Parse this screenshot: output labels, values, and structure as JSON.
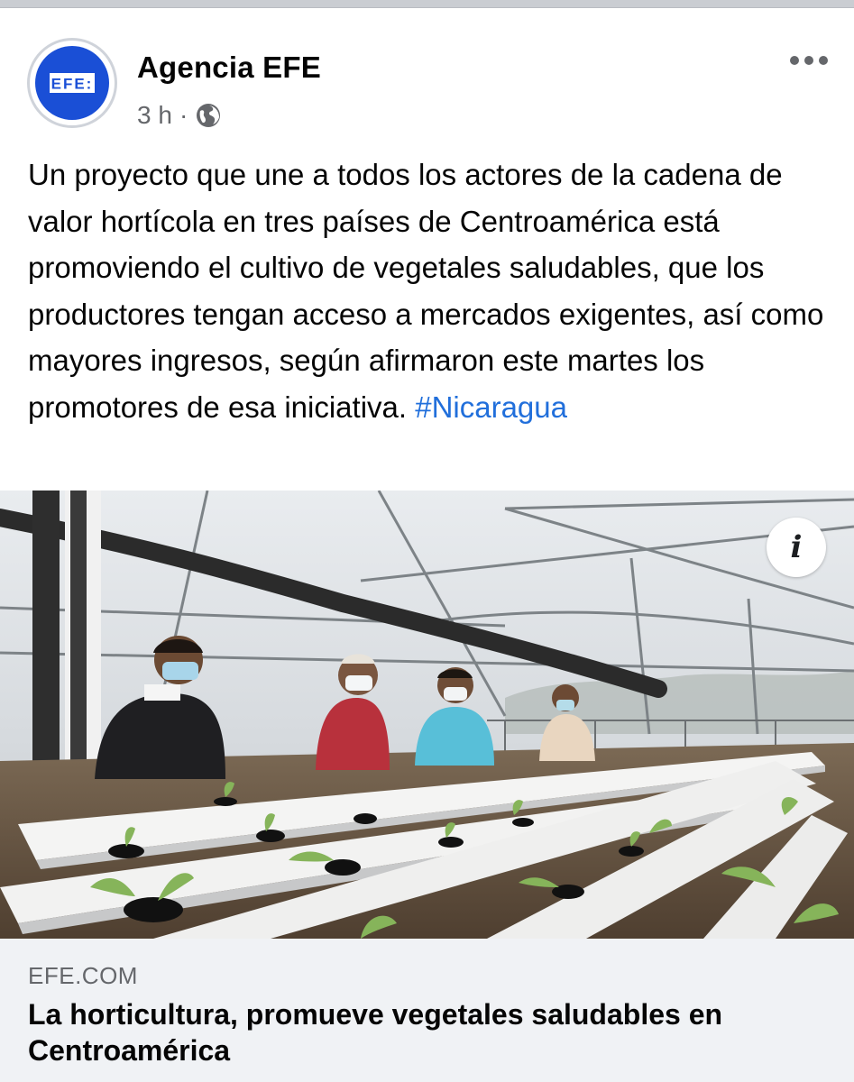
{
  "post": {
    "author": "Agencia EFE",
    "avatar_logo_text": "EFE:",
    "timestamp": "3 h",
    "separator": "·",
    "audience_icon": "globe-icon",
    "more_icon": "more-horizontal-icon",
    "body": "Un proyecto que une a todos los actores de la cadena de valor hortícola en tres países de Centroamérica está promoviendo el cultivo de vegetales saludables, que los productores tengan acceso a mercados exigentes, así como mayores ingresos, según afirmaron este martes los promotores de esa iniciativa.",
    "hashtag": "#Nicaragua"
  },
  "media": {
    "info_icon_label": "i"
  },
  "link_preview": {
    "domain": "EFE.COM",
    "title": "La horticultura, promueve vegetales saludables en Centroamérica"
  },
  "colors": {
    "brand_blue": "#1a4fd6",
    "hashtag_blue": "#216fdb",
    "secondary_text": "#65676b",
    "preview_bg": "#f0f2f5"
  }
}
